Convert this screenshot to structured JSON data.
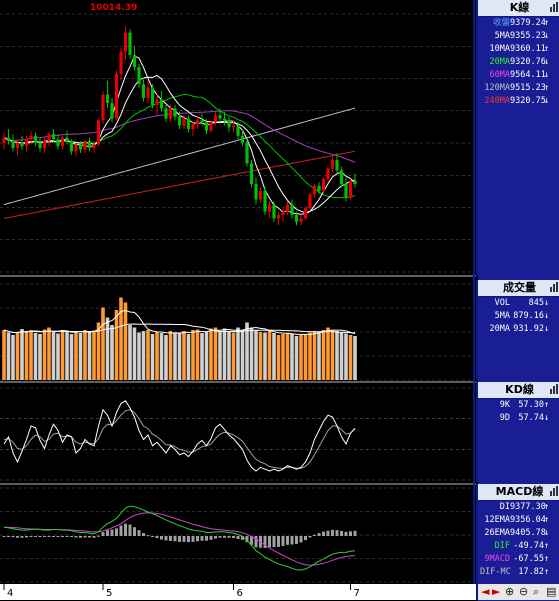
{
  "colors": {
    "up": "#e60000",
    "down": "#00c000",
    "ma5": "#ffffff",
    "ma10": "#ffffff",
    "ma20": "#00c000",
    "ma60": "#a040c0",
    "ma120": "#c0c0c0",
    "ma240": "#cc2020",
    "vol_up": "#ff9933",
    "vol_down": "#d0d0d0",
    "k_line": "#ffffff",
    "d_line": "#a0a0a0",
    "dif": "#33cc33",
    "macd": "#cc44cc",
    "osc": "#a0a0a0",
    "panel_bg": "#1a1e94",
    "grid": "#606060"
  },
  "x_axis": {
    "ticks": [
      "4",
      "5",
      "6",
      "7"
    ]
  },
  "price_panel": {
    "title": "K線",
    "high_marker": "10014.39",
    "legend": [
      {
        "label": "收盤",
        "value": "9379.24",
        "arrow": "↑",
        "color": "#5aa0ff"
      },
      {
        "label": "5MA",
        "value": "9355.23",
        "arrow": "↓",
        "color": "#ffffff"
      },
      {
        "label": "10MA",
        "value": "9360.11",
        "arrow": "↑",
        "color": "#ffffff"
      },
      {
        "label": "20MA",
        "value": "9320.76",
        "arrow": "↓",
        "color": "#33ee33"
      },
      {
        "label": "60MA",
        "value": "9564.11",
        "arrow": "↓",
        "color": "#ee44ee"
      },
      {
        "label": "120MA",
        "value": "9515.23",
        "arrow": "↑",
        "color": "#c0c0c0"
      },
      {
        "label": "240MA",
        "value": "9320.75",
        "arrow": "↓",
        "color": "#ff3333"
      }
    ]
  },
  "volume_panel": {
    "title": "成交量",
    "legend": [
      {
        "label": "VOL",
        "value": "845",
        "arrow": "↓",
        "color": "#ffffff"
      },
      {
        "label": "5MA",
        "value": "879.16",
        "arrow": "↓",
        "color": "#ffffff"
      },
      {
        "label": "20MA",
        "value": "931.92",
        "arrow": "↓",
        "color": "#ffffff"
      }
    ]
  },
  "kd_panel": {
    "title": "KD線",
    "legend": [
      {
        "label": "9K",
        "value": "57.30",
        "arrow": "↑",
        "color": "#ffffff"
      },
      {
        "label": "9D",
        "value": "57.74",
        "arrow": "↓",
        "color": "#ffffff"
      }
    ]
  },
  "macd_panel": {
    "title": "MACD線",
    "legend": [
      {
        "label": "DI",
        "value": "9377.30",
        "arrow": "↑",
        "color": "#ffffff"
      },
      {
        "label": "12EMA",
        "value": "9356.04",
        "arrow": "↑",
        "color": "#ffffff"
      },
      {
        "label": "26EMA",
        "value": "9405.78",
        "arrow": "↓",
        "color": "#ffffff"
      },
      {
        "label": "DIF",
        "value": "-49.74",
        "arrow": "↑",
        "color": "#33ee33"
      },
      {
        "label": "9MACD",
        "value": "-67.55",
        "arrow": "↑",
        "color": "#ee44ee"
      },
      {
        "label": "DIF-MC",
        "value": "17.82",
        "arrow": "↑",
        "color": "#c0c0c0"
      }
    ]
  },
  "chart_data": {
    "type": "candlestick",
    "price_range": [
      8600,
      10100
    ],
    "volume_range": [
      0,
      1800
    ],
    "kd_range": [
      0,
      100
    ],
    "macd_range": [
      -150,
      150
    ],
    "month_starts": {
      "4": 0,
      "5": 22,
      "6": 51,
      "7": 77
    },
    "candles": [
      [
        9340,
        9400,
        9300,
        9370
      ],
      [
        9370,
        9420,
        9330,
        9350
      ],
      [
        9350,
        9390,
        9290,
        9310
      ],
      [
        9310,
        9360,
        9260,
        9340
      ],
      [
        9340,
        9380,
        9300,
        9320
      ],
      [
        9320,
        9380,
        9290,
        9360
      ],
      [
        9360,
        9410,
        9330,
        9380
      ],
      [
        9380,
        9400,
        9320,
        9340
      ],
      [
        9340,
        9370,
        9290,
        9310
      ],
      [
        9310,
        9370,
        9280,
        9350
      ],
      [
        9350,
        9400,
        9320,
        9390
      ],
      [
        9390,
        9420,
        9340,
        9360
      ],
      [
        9360,
        9390,
        9300,
        9320
      ],
      [
        9320,
        9380,
        9300,
        9370
      ],
      [
        9370,
        9410,
        9330,
        9350
      ],
      [
        9350,
        9360,
        9270,
        9290
      ],
      [
        9290,
        9340,
        9260,
        9330
      ],
      [
        9330,
        9350,
        9280,
        9300
      ],
      [
        9300,
        9360,
        9280,
        9350
      ],
      [
        9350,
        9370,
        9290,
        9310
      ],
      [
        9310,
        9350,
        9280,
        9330
      ],
      [
        9330,
        9480,
        9320,
        9470
      ],
      [
        9470,
        9640,
        9450,
        9620
      ],
      [
        9620,
        9700,
        9540,
        9570
      ],
      [
        9570,
        9600,
        9460,
        9480
      ],
      [
        9480,
        9760,
        9470,
        9740
      ],
      [
        9740,
        9890,
        9700,
        9870
      ],
      [
        9870,
        10014,
        9820,
        9980
      ],
      [
        9980,
        10000,
        9830,
        9850
      ],
      [
        9850,
        9900,
        9760,
        9780
      ],
      [
        9780,
        9800,
        9660,
        9680
      ],
      [
        9680,
        9720,
        9580,
        9600
      ],
      [
        9600,
        9700,
        9570,
        9660
      ],
      [
        9660,
        9680,
        9540,
        9560
      ],
      [
        9560,
        9620,
        9500,
        9590
      ],
      [
        9590,
        9640,
        9520,
        9540
      ],
      [
        9540,
        9560,
        9460,
        9480
      ],
      [
        9480,
        9560,
        9460,
        9540
      ],
      [
        9540,
        9560,
        9470,
        9490
      ],
      [
        9490,
        9520,
        9420,
        9440
      ],
      [
        9440,
        9500,
        9420,
        9480
      ],
      [
        9480,
        9500,
        9400,
        9420
      ],
      [
        9420,
        9460,
        9380,
        9450
      ],
      [
        9450,
        9490,
        9420,
        9470
      ],
      [
        9470,
        9510,
        9440,
        9460
      ],
      [
        9460,
        9480,
        9390,
        9410
      ],
      [
        9410,
        9470,
        9400,
        9460
      ],
      [
        9460,
        9520,
        9440,
        9500
      ],
      [
        9500,
        9540,
        9460,
        9480
      ],
      [
        9480,
        9520,
        9440,
        9470
      ],
      [
        9470,
        9490,
        9400,
        9430
      ],
      [
        9430,
        9470,
        9400,
        9440
      ],
      [
        9440,
        9460,
        9360,
        9380
      ],
      [
        9380,
        9420,
        9320,
        9340
      ],
      [
        9340,
        9360,
        9200,
        9220
      ],
      [
        9220,
        9240,
        9080,
        9100
      ],
      [
        9100,
        9140,
        8980,
        9010
      ],
      [
        9010,
        9080,
        8990,
        9060
      ],
      [
        9060,
        9080,
        8920,
        8940
      ],
      [
        8940,
        9000,
        8900,
        8980
      ],
      [
        8980,
        9000,
        8880,
        8900
      ],
      [
        8900,
        8940,
        8860,
        8920
      ],
      [
        8920,
        8960,
        8880,
        8940
      ],
      [
        8940,
        9000,
        8920,
        8980
      ],
      [
        8980,
        9010,
        8900,
        8920
      ],
      [
        8920,
        8940,
        8860,
        8880
      ],
      [
        8880,
        8920,
        8860,
        8900
      ],
      [
        8900,
        8970,
        8890,
        8960
      ],
      [
        8960,
        9050,
        8950,
        9040
      ],
      [
        9040,
        9100,
        9020,
        9090
      ],
      [
        9090,
        9110,
        9040,
        9060
      ],
      [
        9060,
        9140,
        9050,
        9130
      ],
      [
        9130,
        9200,
        9110,
        9190
      ],
      [
        9190,
        9260,
        9170,
        9240
      ],
      [
        9240,
        9280,
        9160,
        9180
      ],
      [
        9180,
        9200,
        9080,
        9100
      ],
      [
        9100,
        9140,
        9000,
        9020
      ],
      [
        9020,
        9130,
        9010,
        9120
      ],
      [
        9120,
        9160,
        9080,
        9100
      ]
    ],
    "volume": [
      1000,
      950,
      900,
      960,
      1020,
      980,
      1000,
      940,
      920,
      1010,
      1050,
      960,
      930,
      1000,
      970,
      920,
      980,
      940,
      1000,
      960,
      990,
      1150,
      1450,
      1250,
      1100,
      1400,
      1650,
      1550,
      1100,
      1050,
      950,
      980,
      1000,
      920,
      960,
      940,
      900,
      980,
      930,
      950,
      980,
      920,
      1000,
      1010,
      940,
      960,
      1030,
      1050,
      980,
      1030,
      960,
      950,
      1050,
      1000,
      1150,
      1050,
      1000,
      960,
      950,
      980,
      940,
      900,
      920,
      940,
      920,
      880,
      900,
      920,
      950,
      980,
      960,
      1000,
      1050,
      1000,
      980,
      950,
      930,
      900,
      880
    ],
    "kd_k": [
      40,
      48,
      30,
      20,
      32,
      45,
      60,
      58,
      44,
      35,
      50,
      62,
      55,
      42,
      50,
      48,
      30,
      35,
      45,
      40,
      38,
      60,
      78,
      72,
      60,
      75,
      85,
      88,
      80,
      70,
      55,
      45,
      50,
      38,
      42,
      36,
      30,
      38,
      34,
      28,
      30,
      26,
      32,
      40,
      44,
      38,
      46,
      58,
      62,
      56,
      50,
      46,
      40,
      34,
      22,
      14,
      10,
      14,
      12,
      10,
      12,
      10,
      12,
      16,
      14,
      12,
      14,
      20,
      30,
      45,
      55,
      65,
      72,
      70,
      60,
      48,
      40,
      52,
      57
    ],
    "kd_d": [
      45,
      46,
      42,
      35,
      34,
      38,
      45,
      50,
      48,
      43,
      45,
      51,
      52,
      48,
      49,
      48,
      42,
      40,
      42,
      41,
      40,
      46,
      57,
      62,
      61,
      66,
      72,
      77,
      78,
      75,
      68,
      60,
      57,
      51,
      48,
      44,
      39,
      39,
      37,
      34,
      33,
      31,
      31,
      34,
      37,
      38,
      40,
      46,
      51,
      53,
      52,
      50,
      47,
      43,
      36,
      29,
      23,
      20,
      18,
      15,
      14,
      13,
      13,
      14,
      14,
      13,
      13,
      15,
      20,
      28,
      37,
      46,
      55,
      60,
      60,
      56,
      51,
      52,
      57.7
    ],
    "macd_dif": [
      30,
      28,
      25,
      22,
      20,
      20,
      22,
      23,
      22,
      20,
      20,
      22,
      22,
      20,
      20,
      18,
      14,
      12,
      12,
      10,
      8,
      15,
      30,
      42,
      50,
      60,
      78,
      95,
      102,
      100,
      95,
      88,
      82,
      76,
      70,
      62,
      55,
      48,
      42,
      35,
      30,
      24,
      20,
      18,
      16,
      12,
      12,
      14,
      15,
      14,
      12,
      10,
      5,
      -2,
      -15,
      -32,
      -50,
      -60,
      -72,
      -80,
      -88,
      -95,
      -100,
      -104,
      -110,
      -115,
      -116,
      -112,
      -105,
      -95,
      -86,
      -78,
      -70,
      -62,
      -58,
      -56,
      -56,
      -52,
      -50
    ],
    "macd_signal": [
      30,
      30,
      29,
      28,
      26,
      25,
      24,
      24,
      23,
      22,
      22,
      22,
      22,
      21,
      21,
      20,
      19,
      18,
      17,
      15,
      14,
      14,
      17,
      22,
      28,
      34,
      42,
      53,
      63,
      70,
      75,
      78,
      79,
      78,
      77,
      74,
      70,
      65,
      60,
      55,
      50,
      45,
      40,
      36,
      32,
      28,
      25,
      23,
      21,
      20,
      18,
      17,
      15,
      11,
      6,
      -2,
      -11,
      -20,
      -31,
      -41,
      -50,
      -58,
      -66,
      -74,
      -81,
      -88,
      -94,
      -98,
      -100,
      -99,
      -96,
      -93,
      -88,
      -83,
      -78,
      -73,
      -70,
      -68,
      -67.5
    ]
  }
}
